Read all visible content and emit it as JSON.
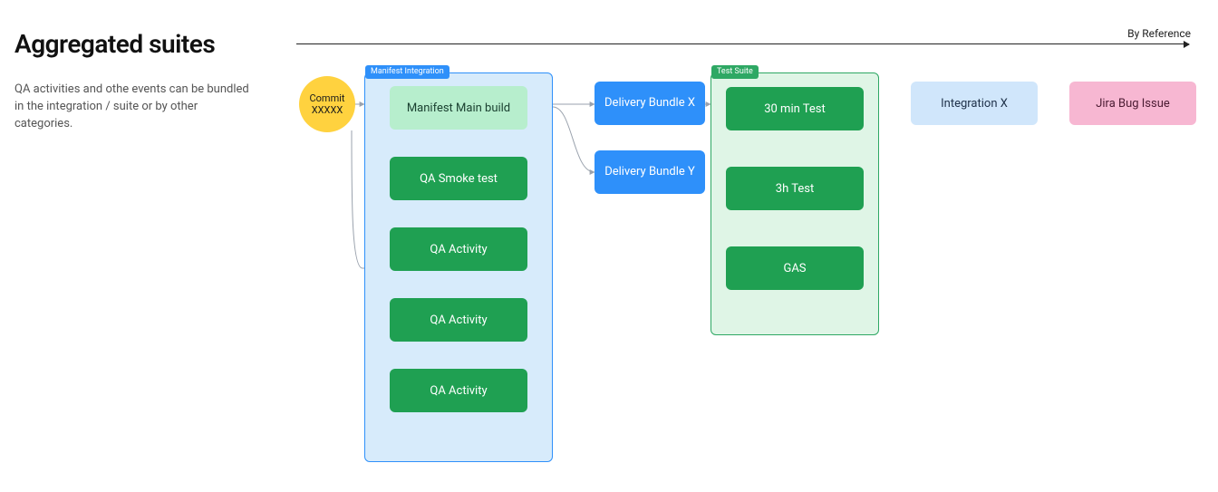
{
  "title": "Aggregated suites",
  "axis_label": "By Reference",
  "description": "QA activities and othe events can be bundled in the integration / suite or by other categories.",
  "commit": {
    "line1": "Commit",
    "line2": "XXXXX"
  },
  "groups": {
    "manifest": {
      "label": "Manifest Integration"
    },
    "suite": {
      "label": "Test Suite"
    }
  },
  "nodes": {
    "manifest_main": "Manifest Main build",
    "qa_smoke": "QA Smoke test",
    "qa1": "QA Activity",
    "qa2": "QA Activity",
    "qa3": "QA Activity",
    "bundle_x": "Delivery Bundle X",
    "bundle_y": "Delivery Bundle Y",
    "t30": "30 min Test",
    "t3h": "3h Test",
    "gas": "GAS",
    "integration_x": "Integration X",
    "jira": "Jira Bug Issue"
  }
}
